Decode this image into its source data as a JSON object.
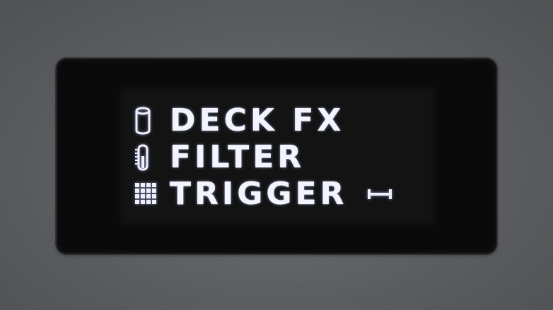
{
  "display": {
    "menu": [
      {
        "label": "DECK FX",
        "icon": "cylinder-icon"
      },
      {
        "label": "FILTER",
        "icon": "filter-knob-icon"
      },
      {
        "label": "TRIGGER",
        "icon": "grid-pads-icon",
        "indicator_icon": "range-bracket-icon"
      }
    ]
  },
  "colors": {
    "body": "#5b5d60",
    "bezel": "#0a0a0b",
    "screen": "#131314",
    "text": "#f2f4ff"
  }
}
